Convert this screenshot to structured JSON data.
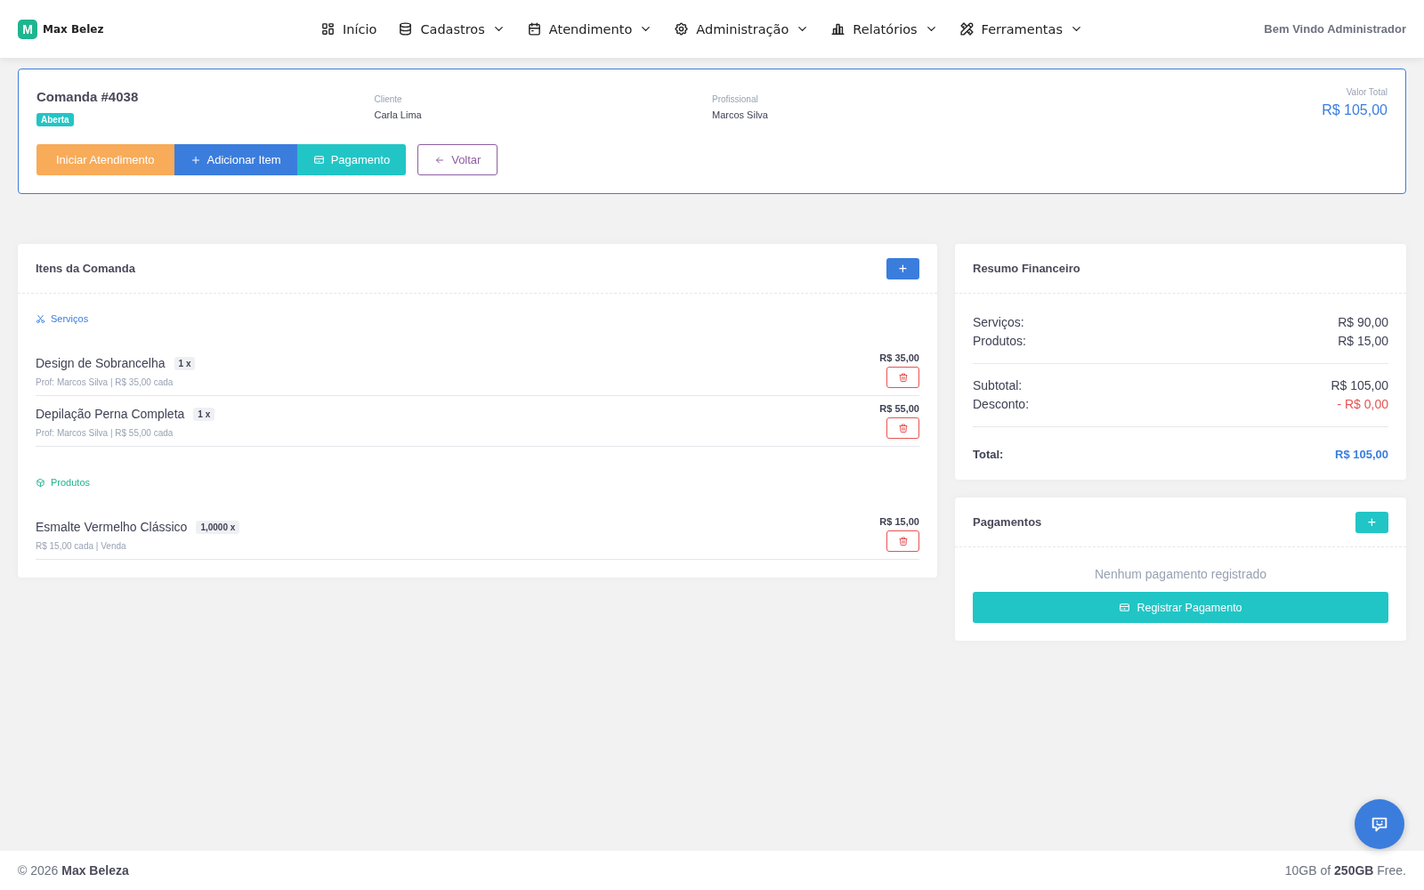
{
  "brand": {
    "logo_letter": "M",
    "name": "Max Belez"
  },
  "nav": [
    {
      "label": "Início",
      "dropdown": false
    },
    {
      "label": "Cadastros",
      "dropdown": true
    },
    {
      "label": "Atendimento",
      "dropdown": true
    },
    {
      "label": "Administração",
      "dropdown": true
    },
    {
      "label": "Relatórios",
      "dropdown": true
    },
    {
      "label": "Ferramentas",
      "dropdown": true
    }
  ],
  "welcome": "Bem Vindo Administrador",
  "order": {
    "title": "Comanda #4038",
    "status": "Aberta",
    "client_label": "Cliente",
    "client": "Carla Lima",
    "professional_label": "Profissional",
    "professional": "Marcos Silva",
    "total_label": "Valor Total",
    "total": "R$ 105,00",
    "actions": [
      {
        "label": "Iniciar Atendimento",
        "kind": "start"
      },
      {
        "label": "Adicionar Item",
        "kind": "add"
      },
      {
        "label": "Pagamento",
        "kind": "payment"
      },
      {
        "label": "Voltar",
        "kind": "back"
      }
    ]
  },
  "items_card": {
    "title": "Itens da Comanda",
    "add_button": "+",
    "sections": [
      {
        "kind": "services",
        "title": "Serviços",
        "items": [
          {
            "name": "Design de Sobrancelha",
            "qty": "1 x",
            "detail": "Prof: Marcos Silva | R$ 35,00 cada",
            "price": "R$ 35,00"
          },
          {
            "name": "Depilação Perna Completa",
            "qty": "1 x",
            "detail": "Prof: Marcos Silva | R$ 55,00 cada",
            "price": "R$ 55,00"
          }
        ]
      },
      {
        "kind": "products",
        "title": "Produtos",
        "items": [
          {
            "name": "Esmalte Vermelho Clássico",
            "qty": "1,0000 x",
            "detail": "R$ 15,00 cada | Venda",
            "price": "R$ 15,00"
          }
        ]
      }
    ]
  },
  "summary": {
    "title": "Resumo Financeiro",
    "groups": [
      [
        {
          "label": "Serviços:",
          "value": "R$ 90,00",
          "kind": "normal"
        },
        {
          "label": "Produtos:",
          "value": "R$ 15,00",
          "kind": "normal"
        }
      ],
      [
        {
          "label": "Subtotal:",
          "value": "R$ 105,00",
          "kind": "normal"
        },
        {
          "label": "Desconto:",
          "value": "- R$ 0,00",
          "kind": "discount"
        }
      ],
      [
        {
          "label": "Total:",
          "value": "R$ 105,00",
          "kind": "total"
        }
      ]
    ]
  },
  "payments": {
    "title": "Pagamentos",
    "add_button": "+",
    "empty": "Nenhum pagamento registrado",
    "register_button": "Registrar Pagamento"
  },
  "footer": {
    "copyright": "© 2026 **Max Beleza**",
    "storage": "10GB of **250GB** Free."
  }
}
